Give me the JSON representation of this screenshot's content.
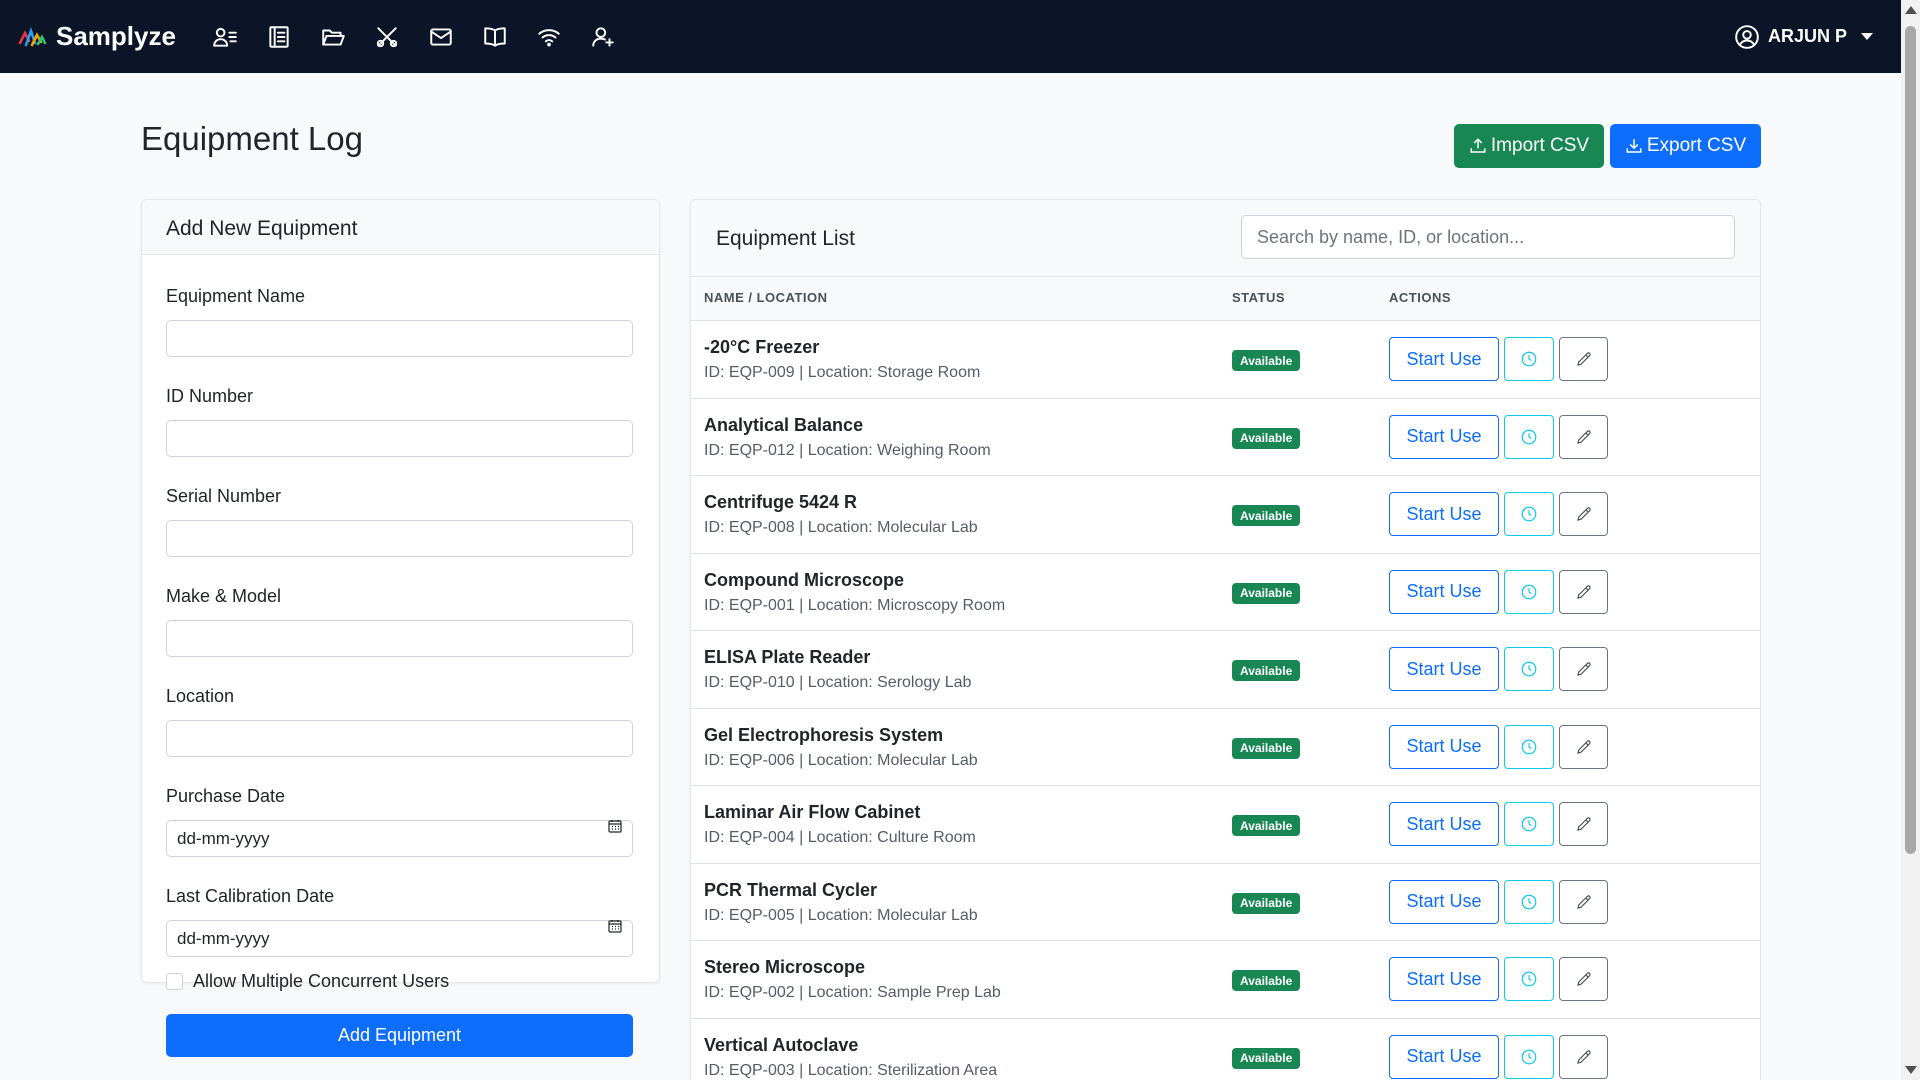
{
  "brand": {
    "name": "Samplyze"
  },
  "nav": {
    "icons": [
      "users-list-icon",
      "notebook-icon",
      "folder-open-icon",
      "tools-icon",
      "envelope-icon",
      "book-icon",
      "wifi-icon",
      "user-plus-icon"
    ]
  },
  "user": {
    "name": "ARJUN P"
  },
  "page": {
    "title": "Equipment Log",
    "import_label": "Import CSV",
    "export_label": "Export CSV"
  },
  "form": {
    "title": "Add New Equipment",
    "name_label": "Equipment Name",
    "id_label": "ID Number",
    "serial_label": "Serial Number",
    "make_label": "Make & Model",
    "location_label": "Location",
    "purchase_label": "Purchase Date",
    "purchase_value": "dd-mm-yyyy",
    "calibration_label": "Last Calibration Date",
    "calibration_value": "dd-mm-yyyy",
    "concurrent_label": "Allow Multiple Concurrent Users",
    "submit_label": "Add Equipment"
  },
  "list": {
    "title": "Equipment List",
    "search_placeholder": "Search by name, ID, or location...",
    "columns": {
      "name": "NAME / LOCATION",
      "status": "STATUS",
      "actions": "ACTIONS"
    },
    "start_label": "Start Use",
    "rows": [
      {
        "name": "-20°C Freezer",
        "meta": "ID: EQP-009 | Location: Storage Room",
        "status": "Available"
      },
      {
        "name": "Analytical Balance",
        "meta": "ID: EQP-012 | Location: Weighing Room",
        "status": "Available"
      },
      {
        "name": "Centrifuge 5424 R",
        "meta": "ID: EQP-008 | Location: Molecular Lab",
        "status": "Available"
      },
      {
        "name": "Compound Microscope",
        "meta": "ID: EQP-001 | Location: Microscopy Room",
        "status": "Available"
      },
      {
        "name": "ELISA Plate Reader",
        "meta": "ID: EQP-010 | Location: Serology Lab",
        "status": "Available"
      },
      {
        "name": "Gel Electrophoresis System",
        "meta": "ID: EQP-006 | Location: Molecular Lab",
        "status": "Available"
      },
      {
        "name": "Laminar Air Flow Cabinet",
        "meta": "ID: EQP-004 | Location: Culture Room",
        "status": "Available"
      },
      {
        "name": "PCR Thermal Cycler",
        "meta": "ID: EQP-005 | Location: Molecular Lab",
        "status": "Available"
      },
      {
        "name": "Stereo Microscope",
        "meta": "ID: EQP-002 | Location: Sample Prep Lab",
        "status": "Available"
      },
      {
        "name": "Vertical Autoclave",
        "meta": "ID: EQP-003 | Location: Sterilization Area",
        "status": "Available"
      }
    ]
  },
  "colors": {
    "navbar": "#0b1527",
    "primary": "#0d6efd",
    "success": "#198754",
    "info": "#0dcaf0"
  }
}
